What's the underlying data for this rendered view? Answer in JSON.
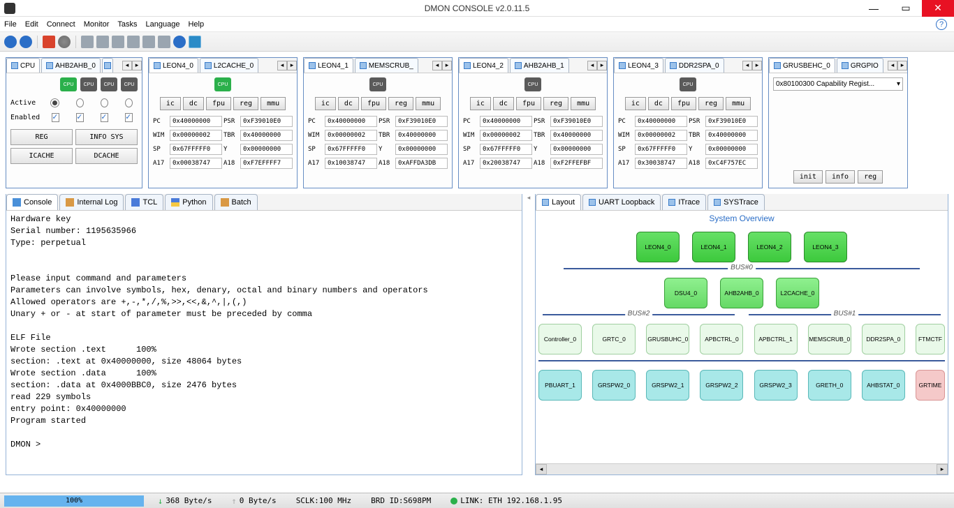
{
  "window": {
    "title": "DMON CONSOLE v2.0.11.5"
  },
  "menu": {
    "items": [
      "File",
      "Edit",
      "Connect",
      "Monitor",
      "Tasks",
      "Language",
      "Help"
    ]
  },
  "cpu_panel": {
    "tabs": [
      "CPU",
      "AHB2AHB_0"
    ],
    "chips": [
      "CPU",
      "CPU",
      "CPU",
      "CPU"
    ],
    "active_label": "Active",
    "enabled_label": "Enabled",
    "buttons": {
      "reg": "REG",
      "info_sys": "INFO SYS",
      "icache": "ICACHE",
      "dcache": "DCACHE"
    }
  },
  "leon_panels": [
    {
      "tabs": [
        "LEON4_0",
        "L2CACHE_0"
      ],
      "chip_on": true,
      "regs": {
        "pc": "0x40000000",
        "psr": "0xF39010E0",
        "wim": "0x00000002",
        "tbr": "0x40000000",
        "sp": "0x67FFFFF0",
        "y": "0x00000000",
        "a17": "0x00038747",
        "a18": "0xF7EFFFF7"
      }
    },
    {
      "tabs": [
        "LEON4_1",
        "MEMSCRUB_"
      ],
      "chip_on": false,
      "regs": {
        "pc": "0x40000000",
        "psr": "0xF39010E0",
        "wim": "0x00000002",
        "tbr": "0x40000000",
        "sp": "0x67FFFFF0",
        "y": "0x00000000",
        "a17": "0x10038747",
        "a18": "0xAFFDA3DB"
      }
    },
    {
      "tabs": [
        "LEON4_2",
        "AHB2AHB_1"
      ],
      "chip_on": false,
      "regs": {
        "pc": "0x40000000",
        "psr": "0xF39010E0",
        "wim": "0x00000002",
        "tbr": "0x40000000",
        "sp": "0x67FFFFF0",
        "y": "0x00000000",
        "a17": "0x20038747",
        "a18": "0xF2FFEFBF"
      }
    },
    {
      "tabs": [
        "LEON4_3",
        "DDR2SPA_0"
      ],
      "chip_on": false,
      "regs": {
        "pc": "0x40000000",
        "psr": "0xF39010E0",
        "wim": "0x00000002",
        "tbr": "0x40000000",
        "sp": "0x67FFFFF0",
        "y": "0x00000000",
        "a17": "0x30038747",
        "a18": "0xC4F757EC"
      }
    }
  ],
  "leon_btn_labels": [
    "ic",
    "dc",
    "fpu",
    "reg",
    "mmu"
  ],
  "leon_reg_labels": {
    "pc": "PC",
    "psr": "PSR",
    "wim": "WIM",
    "tbr": "TBR",
    "sp": "SP",
    "y": "Y",
    "a17": "A17",
    "a18": "A18"
  },
  "cap_panel": {
    "tabs": [
      "GRUSBEHC_0",
      "GRGPIO"
    ],
    "select": "0x80100300 Capability Regist...",
    "buttons": [
      "init",
      "info",
      "reg"
    ]
  },
  "bottom_tabs_left": [
    "Console",
    "Internal Log",
    "TCL",
    "Python",
    "Batch"
  ],
  "bottom_tabs_right": [
    "Layout",
    "UART Loopback",
    "ITrace",
    "SYSTrace"
  ],
  "console_text": "Hardware key\nSerial number: 1195635966\nType: perpetual\n\n\nPlease input command and parameters\nParameters can involve symbols, hex, denary, octal and binary numbers and operators\nAllowed operators are +,-,*,/,%,>>,<<,&,^,|,(,)\nUnary + or - at start of parameter must be preceded by comma\n\nELF File\nWrote section .text      100%\nsection: .text at 0x40000000, size 48064 bytes\nWrote section .data      100%\nsection: .data at 0x4000BBC0, size 2476 bytes\nread 229 symbols\nentry point: 0x40000000\nProgram started\n\nDMON > ",
  "overview": {
    "title": "System Overview",
    "row1": [
      "LEON4_0",
      "LEON4_1",
      "LEON4_2",
      "LEON4_3"
    ],
    "bus0": "BUS#0",
    "row2": [
      "DSU4_0",
      "AHB2AHB_0",
      "L2CACHE_0"
    ],
    "bus1": "BUS#1",
    "bus2": "BUS#2",
    "row3": [
      "Controller_0",
      "GRTC_0",
      "GRUSBUHC_0",
      "APBCTRL_0",
      "APBCTRL_1",
      "MEMSCRUB_0",
      "DDR2SPA_0",
      "FTMCTF"
    ],
    "row4": [
      "PBUART_1",
      "GRSPW2_0",
      "GRSPW2_1",
      "GRSPW2_2",
      "GRSPW2_3",
      "GRETH_0",
      "AHBSTAT_0",
      "GRTIME"
    ]
  },
  "status": {
    "progress": "100%",
    "down": "368 Byte/s",
    "up": "0 Byte/s",
    "sclk": "SCLK:100 MHz",
    "brd": "BRD ID:S698PM",
    "link": "LINK: ETH 192.168.1.95"
  }
}
